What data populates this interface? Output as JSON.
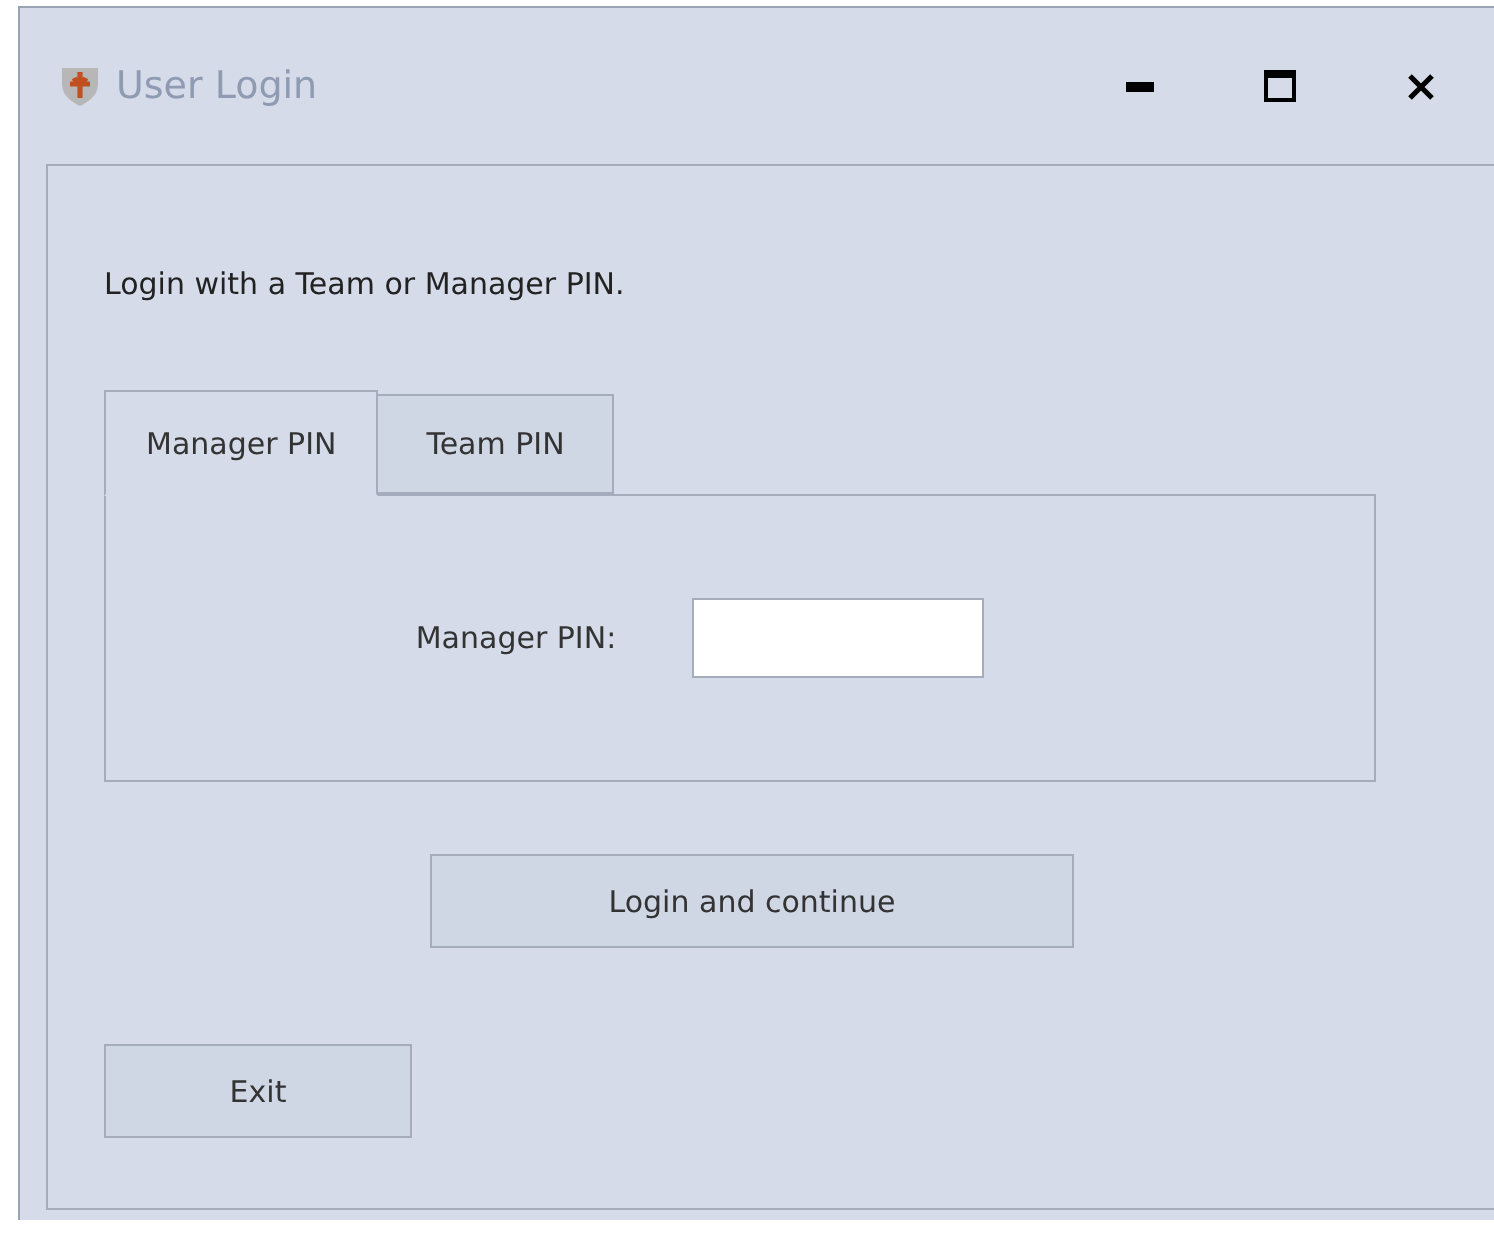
{
  "window": {
    "title": "User Login"
  },
  "instruction": "Login with a Team or Manager PIN.",
  "tabs": [
    {
      "label": "Manager PIN",
      "selected": true
    },
    {
      "label": "Team PIN",
      "selected": false
    }
  ],
  "pin_field": {
    "label": "Manager PIN:"
  },
  "buttons": [
    {
      "kind": "primary",
      "label": "Login and continue"
    },
    {
      "kind": "exit",
      "label": "Exit"
    }
  ]
}
